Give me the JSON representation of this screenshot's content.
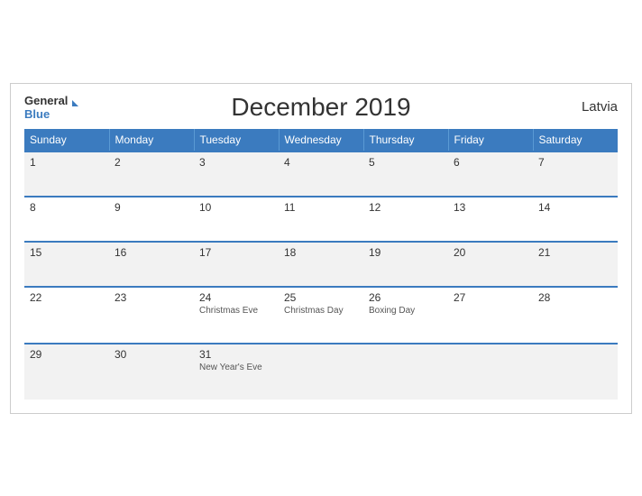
{
  "header": {
    "title": "December 2019",
    "country": "Latvia",
    "logo_general": "General",
    "logo_blue": "Blue"
  },
  "weekdays": [
    "Sunday",
    "Monday",
    "Tuesday",
    "Wednesday",
    "Thursday",
    "Friday",
    "Saturday"
  ],
  "weeks": [
    [
      {
        "day": "1",
        "holiday": ""
      },
      {
        "day": "2",
        "holiday": ""
      },
      {
        "day": "3",
        "holiday": ""
      },
      {
        "day": "4",
        "holiday": ""
      },
      {
        "day": "5",
        "holiday": ""
      },
      {
        "day": "6",
        "holiday": ""
      },
      {
        "day": "7",
        "holiday": ""
      }
    ],
    [
      {
        "day": "8",
        "holiday": ""
      },
      {
        "day": "9",
        "holiday": ""
      },
      {
        "day": "10",
        "holiday": ""
      },
      {
        "day": "11",
        "holiday": ""
      },
      {
        "day": "12",
        "holiday": ""
      },
      {
        "day": "13",
        "holiday": ""
      },
      {
        "day": "14",
        "holiday": ""
      }
    ],
    [
      {
        "day": "15",
        "holiday": ""
      },
      {
        "day": "16",
        "holiday": ""
      },
      {
        "day": "17",
        "holiday": ""
      },
      {
        "day": "18",
        "holiday": ""
      },
      {
        "day": "19",
        "holiday": ""
      },
      {
        "day": "20",
        "holiday": ""
      },
      {
        "day": "21",
        "holiday": ""
      }
    ],
    [
      {
        "day": "22",
        "holiday": ""
      },
      {
        "day": "23",
        "holiday": ""
      },
      {
        "day": "24",
        "holiday": "Christmas Eve"
      },
      {
        "day": "25",
        "holiday": "Christmas Day"
      },
      {
        "day": "26",
        "holiday": "Boxing Day"
      },
      {
        "day": "27",
        "holiday": ""
      },
      {
        "day": "28",
        "holiday": ""
      }
    ],
    [
      {
        "day": "29",
        "holiday": ""
      },
      {
        "day": "30",
        "holiday": ""
      },
      {
        "day": "31",
        "holiday": "New Year's Eve"
      },
      {
        "day": "",
        "holiday": ""
      },
      {
        "day": "",
        "holiday": ""
      },
      {
        "day": "",
        "holiday": ""
      },
      {
        "day": "",
        "holiday": ""
      }
    ]
  ]
}
